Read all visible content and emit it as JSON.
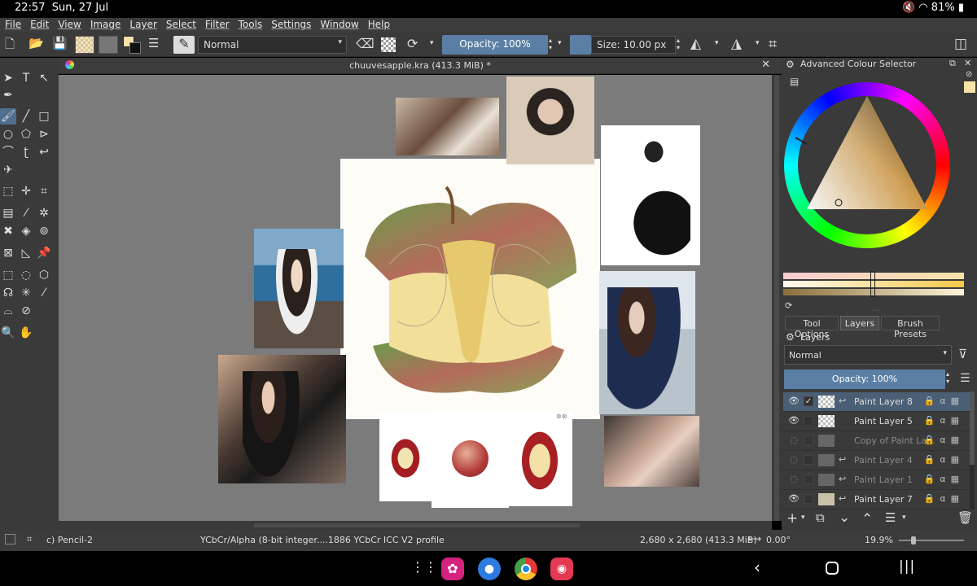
{
  "status": {
    "time": "22:57",
    "date": "Sun, 27 Jul",
    "battery": "81%",
    "icons": [
      "mute-icon",
      "wifi-icon",
      "battery-icon"
    ]
  },
  "menu": [
    "File",
    "Edit",
    "View",
    "Image",
    "Layer",
    "Select",
    "Filter",
    "Tools",
    "Settings",
    "Window",
    "Help"
  ],
  "toolbar": {
    "blend_mode": "Normal",
    "opacity": "Opacity: 100%",
    "size": "Size: 10.00 px"
  },
  "document": {
    "tab_title": "chuuvesapple.kra (413.3 MiB) *"
  },
  "color_selector": {
    "title": "Advanced Colour Selector"
  },
  "right_tabs": [
    "Tool Options",
    "Layers",
    "Brush Presets"
  ],
  "layers_panel": {
    "title": "Layers",
    "blend_mode": "Normal",
    "opacity": "Opacity:  100%",
    "layers": [
      {
        "name": "Paint Layer 8",
        "visible": true,
        "selected": true
      },
      {
        "name": "Paint Layer 5",
        "visible": true,
        "selected": false
      },
      {
        "name": "Copy of Paint La...",
        "visible": false,
        "selected": false
      },
      {
        "name": "Paint Layer 4",
        "visible": false,
        "selected": false
      },
      {
        "name": "Paint Layer 1",
        "visible": false,
        "selected": false
      },
      {
        "name": "Paint Layer 7",
        "visible": true,
        "selected": false
      }
    ]
  },
  "statusbar": {
    "brush": "c) Pencil-2",
    "color_space": "YCbCr/Alpha (8-bit integer....1886 YCbCr ICC V2 profile",
    "dimensions": "2,680 x 2,680 (413.3 MiB)",
    "rotation": "0.00°",
    "zoom": "19.9%"
  },
  "colors": {
    "accent": "#5b7fa4",
    "canvas_bg": "#7b7b7b",
    "panel_bg": "#3a3a3a"
  }
}
